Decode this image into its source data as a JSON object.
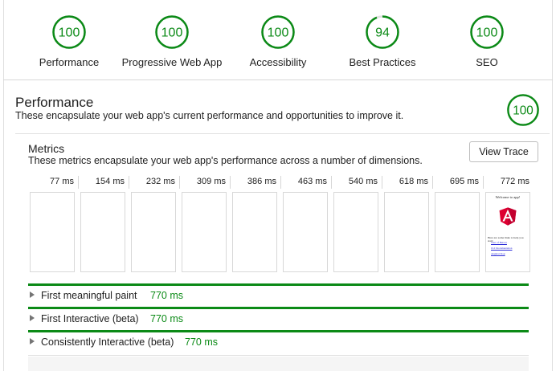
{
  "scores": [
    {
      "value": "100",
      "label": "Performance",
      "fraction": 1.0
    },
    {
      "value": "100",
      "label": "Progressive Web App",
      "fraction": 1.0
    },
    {
      "value": "100",
      "label": "Accessibility",
      "fraction": 1.0
    },
    {
      "value": "94",
      "label": "Best Practices",
      "fraction": 0.94
    },
    {
      "value": "100",
      "label": "SEO",
      "fraction": 1.0
    }
  ],
  "performance": {
    "title": "Performance",
    "description": "These encapsulate your web app's current performance and opportunities to improve it.",
    "score": "100",
    "fraction": 1.0
  },
  "metrics": {
    "title": "Metrics",
    "description": "These metrics encapsulate your web app's performance across a number of dimensions.",
    "view_trace_label": "View Trace",
    "filmstrip": [
      "77 ms",
      "154 ms",
      "232 ms",
      "309 ms",
      "386 ms",
      "463 ms",
      "540 ms",
      "618 ms",
      "695 ms",
      "772 ms"
    ],
    "final_frame": {
      "title": "Welcome to app!",
      "text": "Here are some links to help you start:",
      "links": [
        "Tour of Heroes",
        "CLI Documentation",
        "Angular blog"
      ]
    },
    "rows": [
      {
        "label": "First meaningful paint",
        "value": "770 ms"
      },
      {
        "label": "First Interactive (beta)",
        "value": "770 ms"
      },
      {
        "label": "Consistently Interactive (beta)",
        "value": "770 ms"
      }
    ]
  },
  "colors": {
    "pass_green": "#0b8a16",
    "angular_red": "#dd0031",
    "angular_dark_red": "#c3002f"
  }
}
